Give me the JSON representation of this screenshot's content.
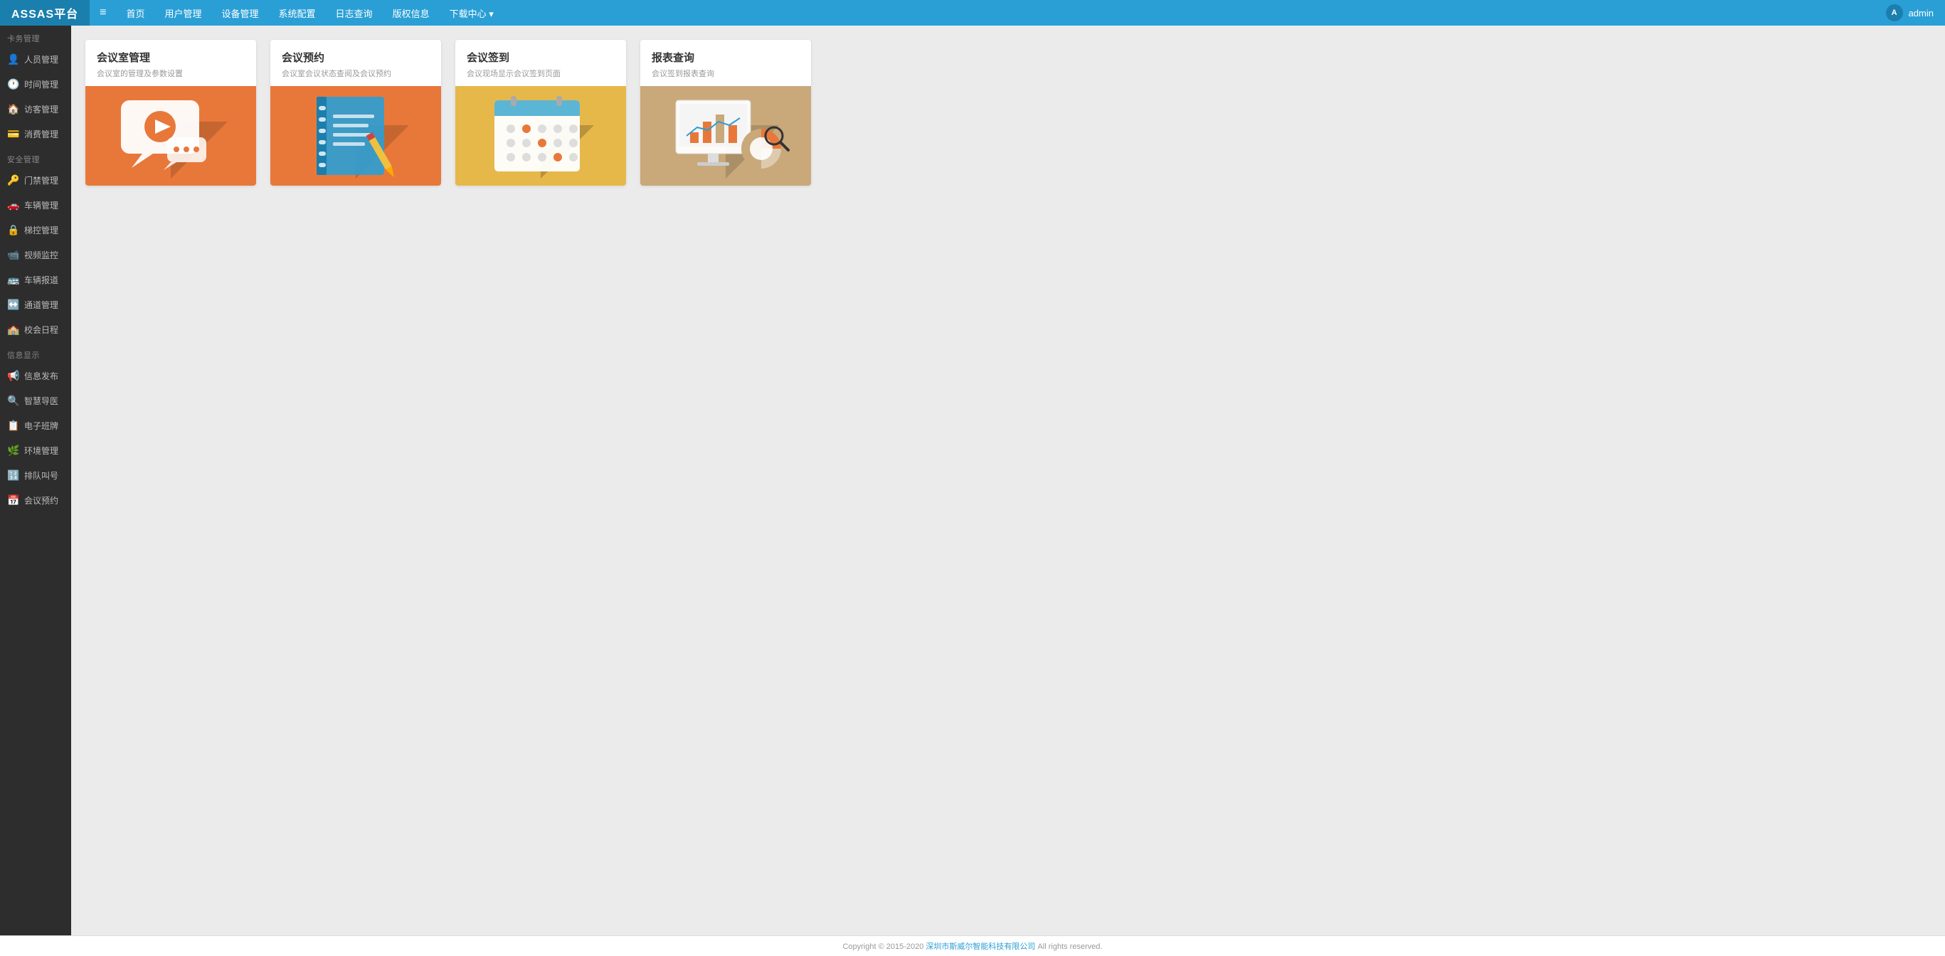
{
  "brand": "ASSAS平台",
  "topnav": {
    "hamburger": "≡",
    "links": [
      {
        "label": "首页",
        "active": false
      },
      {
        "label": "用户管理",
        "active": false
      },
      {
        "label": "设备管理",
        "active": false
      },
      {
        "label": "系统配置",
        "active": false
      },
      {
        "label": "日志查询",
        "active": false
      },
      {
        "label": "版权信息",
        "active": false
      },
      {
        "label": "下载中心 ▾",
        "active": false
      }
    ],
    "user": "admin"
  },
  "sidebar": {
    "sections": [
      {
        "title": "卡务管理",
        "items": [
          {
            "icon": "👤",
            "label": "人员管理"
          },
          {
            "icon": "🕐",
            "label": "时间管理"
          },
          {
            "icon": "🏠",
            "label": "访客管理"
          },
          {
            "icon": "💳",
            "label": "消费管理"
          }
        ]
      },
      {
        "title": "安全管理",
        "items": [
          {
            "icon": "🔑",
            "label": "门禁管理"
          },
          {
            "icon": "🚗",
            "label": "车辆管理"
          },
          {
            "icon": "🔒",
            "label": "梯控管理"
          },
          {
            "icon": "📹",
            "label": "视频监控"
          },
          {
            "icon": "🚌",
            "label": "车辆报道"
          },
          {
            "icon": "↔️",
            "label": "通道管理"
          },
          {
            "icon": "🏫",
            "label": "校会日程"
          }
        ]
      },
      {
        "title": "信息显示",
        "items": [
          {
            "icon": "📢",
            "label": "信息发布"
          },
          {
            "icon": "🔍",
            "label": "智慧导医"
          },
          {
            "icon": "📋",
            "label": "电子班牌"
          },
          {
            "icon": "🌿",
            "label": "环境管理"
          },
          {
            "icon": "🔢",
            "label": "排队叫号"
          },
          {
            "icon": "📅",
            "label": "会议预约"
          }
        ]
      }
    ]
  },
  "main": {
    "cards": [
      {
        "id": "meeting-room",
        "title": "会议室管理",
        "subtitle": "会议室的管理及参数设置",
        "color": "orange",
        "illustration": "chat"
      },
      {
        "id": "meeting-reserve",
        "title": "会议预约",
        "subtitle": "会议室会议状态查阅及会议预约",
        "color": "orange2",
        "illustration": "notebook"
      },
      {
        "id": "meeting-checkin",
        "title": "会议签到",
        "subtitle": "会议现场显示会议签到页面",
        "color": "yellow",
        "illustration": "calendar"
      },
      {
        "id": "report-query",
        "title": "报表查询",
        "subtitle": "会议签到报表查询",
        "color": "tan",
        "illustration": "chart"
      }
    ]
  },
  "footer": {
    "text": "Copyright © 2015-2020 ",
    "link_text": "深圳市斯威尔智能科技有限公司",
    "suffix": "  All rights reserved."
  }
}
